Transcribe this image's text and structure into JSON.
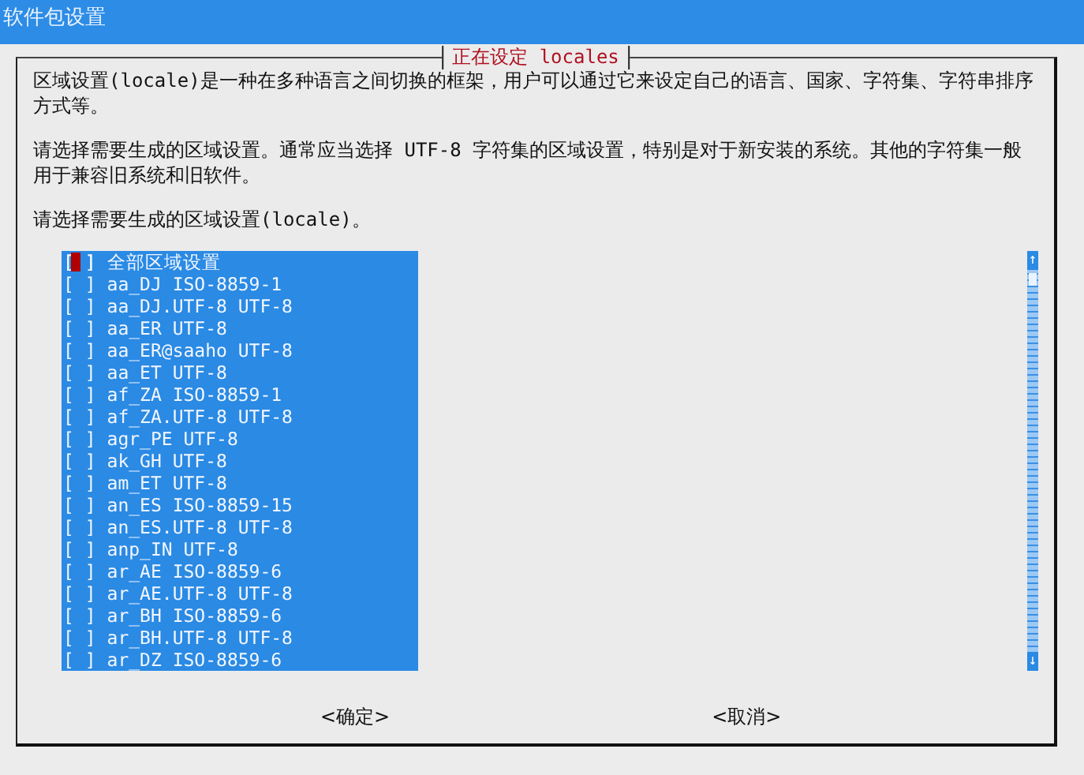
{
  "window": {
    "title": "软件包设置"
  },
  "dialog": {
    "title": "正在设定 locales",
    "paragraphs": [
      "区域设置(locale)是一种在多种语言之间切换的框架，用户可以通过它来设定自己的语言、国家、字符集、字符串排序方式等。",
      "请选择需要生成的区域设置。通常应当选择 UTF-8 字符集的区域设置，特别是对于新安装的系统。其他的字符集一般用于兼容旧系统和旧软件。",
      "请选择需要生成的区域设置(locale)。"
    ],
    "items": [
      {
        "checkbox": "[ ]",
        "label": "全部区域设置",
        "checked": false,
        "selected": true
      },
      {
        "checkbox": "[ ]",
        "label": "aa_DJ ISO-8859-1",
        "checked": false,
        "selected": false
      },
      {
        "checkbox": "[ ]",
        "label": "aa_DJ.UTF-8 UTF-8",
        "checked": false,
        "selected": false
      },
      {
        "checkbox": "[ ]",
        "label": "aa_ER UTF-8",
        "checked": false,
        "selected": false
      },
      {
        "checkbox": "[ ]",
        "label": "aa_ER@saaho UTF-8",
        "checked": false,
        "selected": false
      },
      {
        "checkbox": "[ ]",
        "label": "aa_ET UTF-8",
        "checked": false,
        "selected": false
      },
      {
        "checkbox": "[ ]",
        "label": "af_ZA ISO-8859-1",
        "checked": false,
        "selected": false
      },
      {
        "checkbox": "[ ]",
        "label": "af_ZA.UTF-8 UTF-8",
        "checked": false,
        "selected": false
      },
      {
        "checkbox": "[ ]",
        "label": "agr_PE UTF-8",
        "checked": false,
        "selected": false
      },
      {
        "checkbox": "[ ]",
        "label": "ak_GH UTF-8",
        "checked": false,
        "selected": false
      },
      {
        "checkbox": "[ ]",
        "label": "am_ET UTF-8",
        "checked": false,
        "selected": false
      },
      {
        "checkbox": "[ ]",
        "label": "an_ES ISO-8859-15",
        "checked": false,
        "selected": false
      },
      {
        "checkbox": "[ ]",
        "label": "an_ES.UTF-8 UTF-8",
        "checked": false,
        "selected": false
      },
      {
        "checkbox": "[ ]",
        "label": "anp_IN UTF-8",
        "checked": false,
        "selected": false
      },
      {
        "checkbox": "[ ]",
        "label": "ar_AE ISO-8859-6",
        "checked": false,
        "selected": false
      },
      {
        "checkbox": "[ ]",
        "label": "ar_AE.UTF-8 UTF-8",
        "checked": false,
        "selected": false
      },
      {
        "checkbox": "[ ]",
        "label": "ar_BH ISO-8859-6",
        "checked": false,
        "selected": false
      },
      {
        "checkbox": "[ ]",
        "label": "ar_BH.UTF-8 UTF-8",
        "checked": false,
        "selected": false
      },
      {
        "checkbox": "[ ]",
        "label": "ar_DZ ISO-8859-6",
        "checked": false,
        "selected": false
      }
    ],
    "scrollbar": {
      "up": "↑",
      "down": "↓"
    },
    "buttons": [
      "<确定>",
      "<取消>"
    ]
  }
}
